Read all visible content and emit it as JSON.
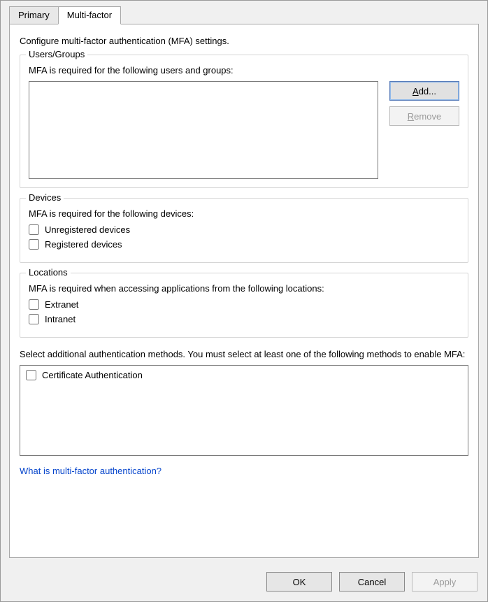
{
  "tabs": {
    "primary": "Primary",
    "multifactor": "Multi-factor"
  },
  "intro": "Configure multi-factor authentication (MFA) settings.",
  "usersGroups": {
    "title": "Users/Groups",
    "desc": "MFA is required for the following users and groups:",
    "addLabel": "Add...",
    "removeLabel": "Remove"
  },
  "devices": {
    "title": "Devices",
    "desc": "MFA is required for the following devices:",
    "unregistered": "Unregistered devices",
    "registered": "Registered devices"
  },
  "locations": {
    "title": "Locations",
    "desc": "MFA is required when accessing applications from the following locations:",
    "extranet": "Extranet",
    "intranet": "Intranet"
  },
  "methods": {
    "desc": "Select additional authentication methods. You must select at least one of the following methods to enable MFA:",
    "cert": "Certificate Authentication"
  },
  "helpLink": "What is multi-factor authentication?",
  "buttons": {
    "ok": "OK",
    "cancel": "Cancel",
    "apply": "Apply"
  }
}
